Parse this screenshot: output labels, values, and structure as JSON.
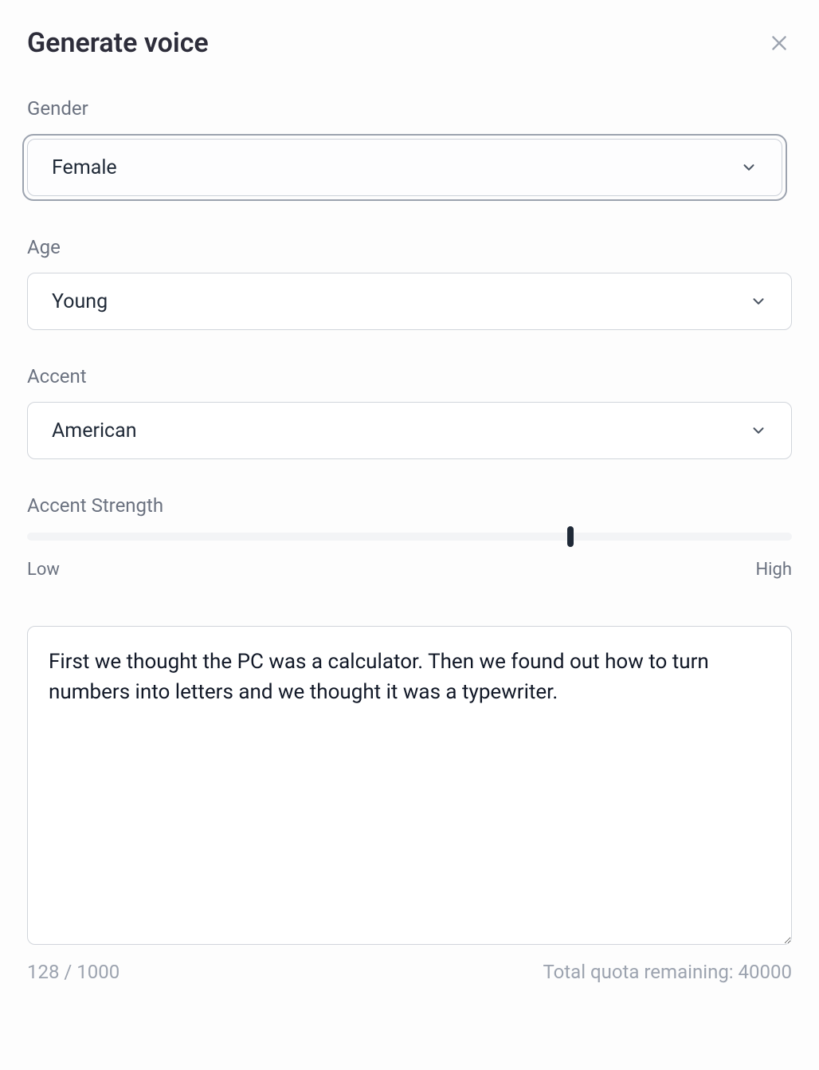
{
  "header": {
    "title": "Generate voice"
  },
  "fields": {
    "gender": {
      "label": "Gender",
      "value": "Female"
    },
    "age": {
      "label": "Age",
      "value": "Young"
    },
    "accent": {
      "label": "Accent",
      "value": "American"
    },
    "accentStrength": {
      "label": "Accent Strength",
      "lowLabel": "Low",
      "highLabel": "High",
      "value": 71
    }
  },
  "textarea": {
    "value": "First we thought the PC was a calculator. Then we found out how to turn numbers into letters and we thought it was a typewriter."
  },
  "footer": {
    "charCount": "128 / 1000",
    "quotaLabel": "Total quota remaining: 40000"
  }
}
